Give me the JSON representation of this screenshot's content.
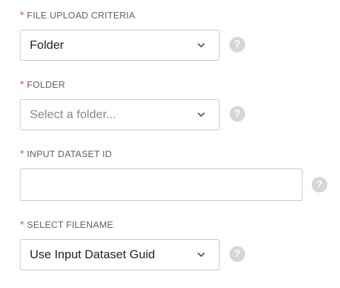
{
  "required_marker": "*",
  "help_glyph": "?",
  "fields": [
    {
      "label": "FILE UPLOAD CRITERIA",
      "type": "select",
      "value": "Folder",
      "placeholder": ""
    },
    {
      "label": "FOLDER",
      "type": "select",
      "value": "",
      "placeholder": "Select a folder..."
    },
    {
      "label": "INPUT DATASET ID",
      "type": "text",
      "value": "",
      "placeholder": ""
    },
    {
      "label": "SELECT FILENAME",
      "type": "select",
      "value": "Use Input Dataset Guid",
      "placeholder": ""
    }
  ],
  "icons": {
    "dropdown": "chevron-down-icon",
    "help": "help-question-icon"
  },
  "colors": {
    "required": "#e05a47",
    "border": "#c8c8c8",
    "help_bg": "#d6d6d6",
    "label": "#5f6368"
  }
}
